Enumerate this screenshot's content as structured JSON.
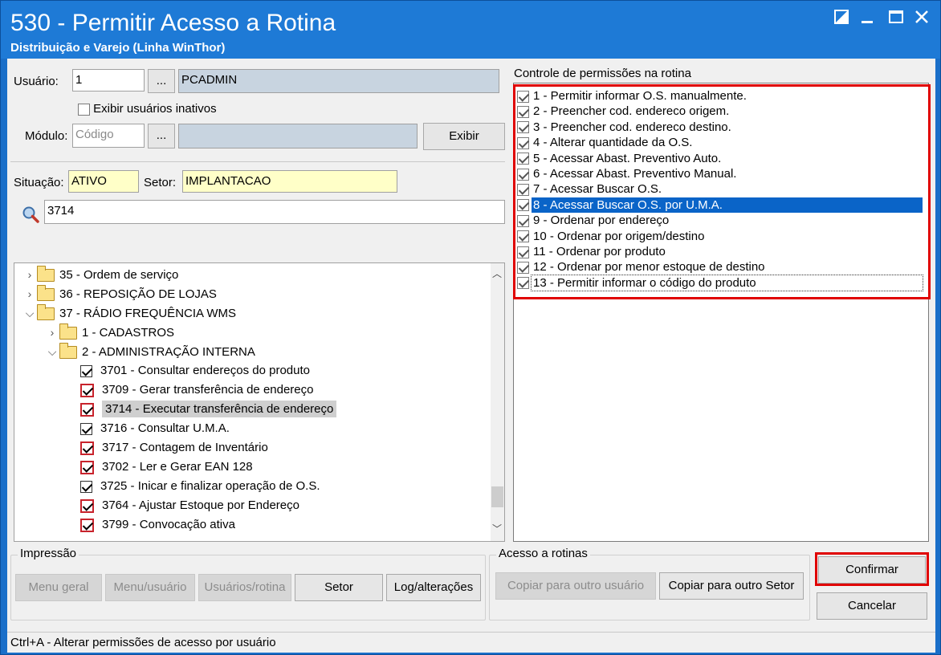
{
  "window": {
    "title": "530 - Permitir Acesso a Rotina",
    "subtitle": "Distribuição e Varejo (Linha WinThor)"
  },
  "user": {
    "label": "Usuário:",
    "code": "1",
    "browse": "...",
    "name": "PCADMIN",
    "show_inactive_label": "Exibir usuários inativos"
  },
  "module": {
    "label": "Módulo:",
    "placeholder": "Código",
    "browse": "...",
    "show_button": "Exibir"
  },
  "status": {
    "situacao_label": "Situação:",
    "situacao_value": "ATIVO",
    "setor_label": "Setor:",
    "setor_value": "IMPLANTACAO"
  },
  "search": {
    "value": "3714"
  },
  "tree": {
    "items": [
      {
        "label": "35 - Ordem de serviço",
        "type": "folder",
        "expanded": false
      },
      {
        "label": "36 - REPOSIÇÃO DE LOJAS",
        "type": "folder",
        "expanded": false
      },
      {
        "label": "37 - RÁDIO FREQUÊNCIA WMS",
        "type": "folder",
        "expanded": true
      },
      {
        "label": "1 - CADASTROS",
        "type": "folder",
        "expanded": false
      },
      {
        "label": "2 - ADMINISTRAÇÃO INTERNA",
        "type": "folder",
        "expanded": true
      },
      {
        "label": "3701 - Consultar endereços do produto",
        "type": "check",
        "checked": true,
        "red": false
      },
      {
        "label": "3709 - Gerar transferência de endereço",
        "type": "check",
        "checked": true,
        "red": true
      },
      {
        "label": "3714 - Executar transferência de endereço",
        "type": "check",
        "checked": true,
        "red": true,
        "selected": true
      },
      {
        "label": "3716 - Consultar U.M.A.",
        "type": "check",
        "checked": true,
        "red": false
      },
      {
        "label": "3717 - Contagem de Inventário",
        "type": "check",
        "checked": true,
        "red": true
      },
      {
        "label": "3702 - Ler e Gerar EAN 128",
        "type": "check",
        "checked": true,
        "red": true
      },
      {
        "label": "3725 - Inicar e finalizar operação de O.S.",
        "type": "check",
        "checked": true,
        "red": false
      },
      {
        "label": "3764 - Ajustar Estoque por Endereço",
        "type": "check",
        "checked": true,
        "red": true
      },
      {
        "label": "3799 - Convocação ativa",
        "type": "check",
        "checked": true,
        "red": true
      }
    ]
  },
  "permissions": {
    "title": "Controle de permissões na rotina",
    "items": [
      {
        "label": "1 - Permitir informar O.S. manualmente.",
        "checked": true
      },
      {
        "label": "2 - Preencher cod. endereco origem.",
        "checked": true
      },
      {
        "label": "3 - Preencher cod. endereco destino.",
        "checked": true
      },
      {
        "label": "4 - Alterar quantidade da O.S.",
        "checked": true
      },
      {
        "label": "5 - Acessar Abast. Preventivo Auto.",
        "checked": true
      },
      {
        "label": "6 - Acessar Abast. Preventivo Manual.",
        "checked": true
      },
      {
        "label": "7 - Acessar Buscar O.S.",
        "checked": true
      },
      {
        "label": "8 - Acessar Buscar O.S. por U.M.A.",
        "checked": true,
        "selected": true
      },
      {
        "label": "9 - Ordenar por endereço",
        "checked": true
      },
      {
        "label": "10 - Ordenar por origem/destino",
        "checked": true
      },
      {
        "label": "11 - Ordenar por produto",
        "checked": true
      },
      {
        "label": "12 - Ordenar por menor estoque de destino",
        "checked": true
      },
      {
        "label": "13 - Permitir informar o código do produto",
        "checked": true,
        "focused": true
      }
    ]
  },
  "impressao": {
    "title": "Impressão",
    "menu_geral": "Menu geral",
    "menu_usuario": "Menu/usuário",
    "usuarios_rotina": "Usuários/rotina",
    "setor": "Setor",
    "log": "Log/alterações"
  },
  "acesso": {
    "title": "Acesso a rotinas",
    "copiar_usuario": "Copiar para outro usuário",
    "copiar_setor": "Copiar para outro Setor"
  },
  "actions": {
    "confirmar": "Confirmar",
    "cancelar": "Cancelar"
  },
  "statusbar": {
    "text": "Ctrl+A - Alterar permissões de acesso por usuário"
  },
  "colors": {
    "titlebar": "#1e7ad6",
    "highlight": "#e00000",
    "selection": "#0a64c8"
  }
}
